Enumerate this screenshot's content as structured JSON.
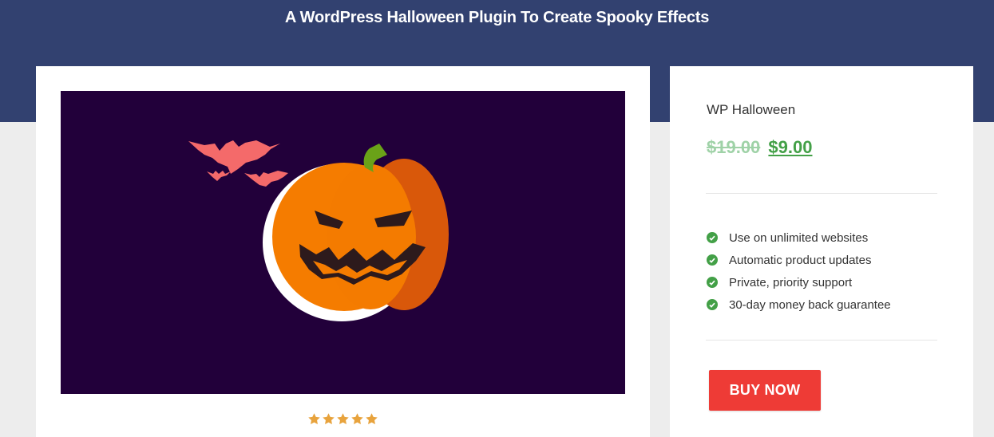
{
  "page": {
    "title": "A WordPress Halloween Plugin To Create Spooky Effects"
  },
  "product": {
    "name": "WP Halloween",
    "old_price": "$19.00",
    "new_price": "$9.00",
    "image_icon": "pumpkin-with-bats-illustration",
    "rating": 5,
    "rating_max": 5
  },
  "features": [
    "Use on unlimited websites",
    "Automatic product updates",
    "Private, priority support",
    "30-day money back guarantee"
  ],
  "buy_button": {
    "label": "BUY NOW"
  },
  "colors": {
    "header_bg": "#324170",
    "image_bg": "#22003a",
    "price_green": "#43a047",
    "old_price_green": "#9fd2a7",
    "buy_red": "#ee3b36",
    "star_gold": "#e8a33d",
    "pumpkin_orange": "#f57c00",
    "bat_coral": "#f46a6a"
  }
}
